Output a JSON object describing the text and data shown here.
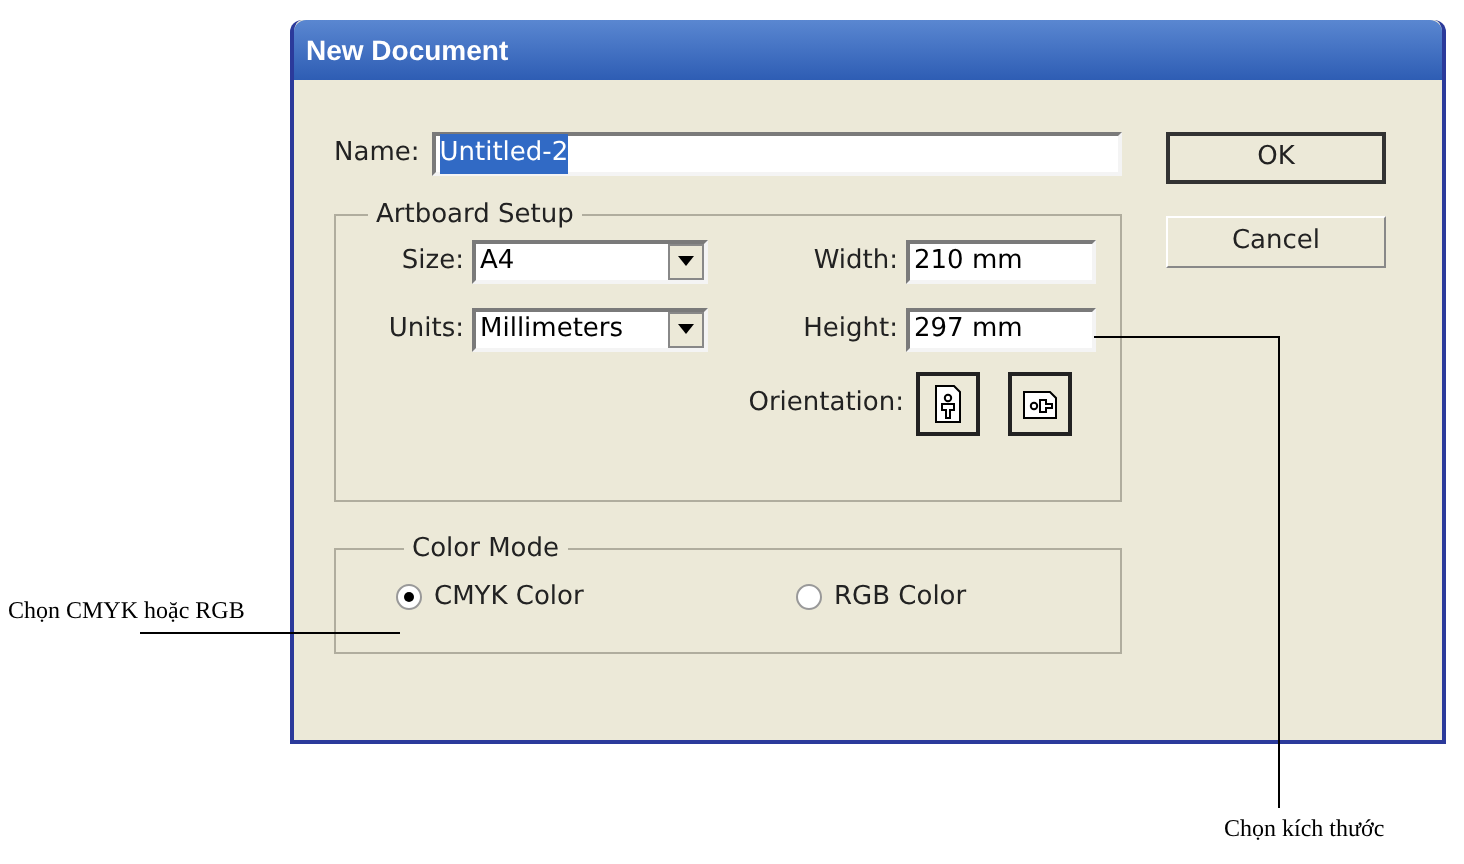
{
  "window": {
    "title": "New Document"
  },
  "name_field": {
    "label": "Name:",
    "value": "Untitled-2",
    "text_selected": true
  },
  "buttons": [
    {
      "label": "OK",
      "default": true
    },
    {
      "label": "Cancel",
      "default": false
    }
  ],
  "artboard_setup": {
    "title": "Artboard Setup",
    "size": {
      "label": "Size:",
      "value": "A4"
    },
    "units": {
      "label": "Units:",
      "value": "Millimeters"
    },
    "width": {
      "label": "Width:",
      "value": "210 mm"
    },
    "height": {
      "label": "Height:",
      "value": "297 mm"
    },
    "orientation": {
      "label": "Orientation:",
      "options": [
        {
          "kind": "portrait"
        },
        {
          "kind": "landscape"
        }
      ]
    }
  },
  "color_mode": {
    "title": "Color Mode",
    "options": [
      {
        "label": "CMYK Color",
        "selected": true
      },
      {
        "label": "RGB Color",
        "selected": false
      }
    ]
  },
  "annotations": [
    {
      "text": "Chọn CMYK hoặc RGB"
    },
    {
      "text": "Chọn kích thước"
    }
  ]
}
